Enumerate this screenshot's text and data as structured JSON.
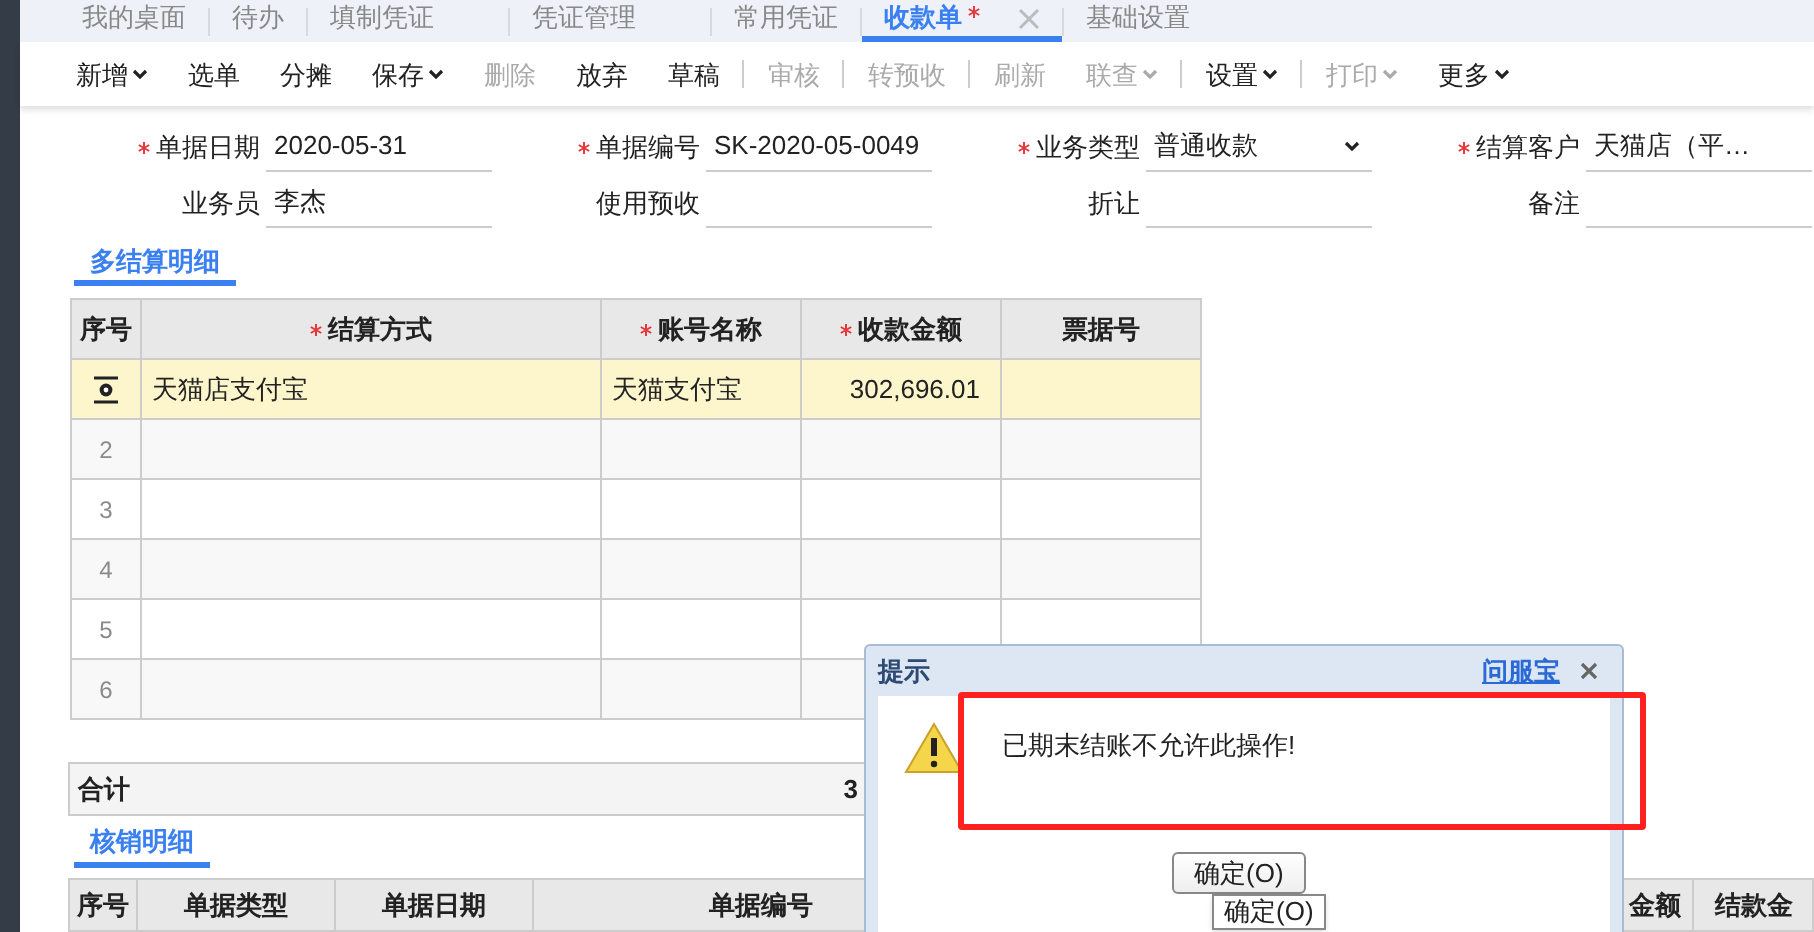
{
  "nav_tabs": [
    {
      "label": "我的桌面",
      "selected": false
    },
    {
      "label": "待办",
      "selected": false
    },
    {
      "label": "填制凭证",
      "selected": false
    },
    {
      "label": "凭证管理",
      "selected": false
    },
    {
      "label": "常用凭证",
      "selected": false
    },
    {
      "label": "收款单",
      "selected": true,
      "modified": true,
      "closable": true
    },
    {
      "label": "基础设置",
      "selected": false
    }
  ],
  "toolbar": [
    {
      "label": "新增",
      "disabled": false,
      "dropdown": true
    },
    {
      "label": "选单",
      "disabled": false
    },
    {
      "label": "分摊",
      "disabled": false
    },
    {
      "label": "保存",
      "disabled": false,
      "dropdown": true
    },
    {
      "label": "删除",
      "disabled": true
    },
    {
      "label": "放弃",
      "disabled": false
    },
    {
      "label": "草稿",
      "disabled": false
    },
    {
      "label": "审核",
      "disabled": true,
      "separator_before": true
    },
    {
      "label": "转预收",
      "disabled": true,
      "separator_before": true
    },
    {
      "label": "刷新",
      "disabled": true,
      "separator_before": true
    },
    {
      "label": "联查",
      "disabled": true,
      "dropdown": true
    },
    {
      "label": "设置",
      "disabled": false,
      "dropdown": true,
      "separator_before": true
    },
    {
      "label": "打印",
      "disabled": true,
      "dropdown": true,
      "separator_before": true
    },
    {
      "label": "更多",
      "disabled": false,
      "dropdown": true
    }
  ],
  "form_rows": [
    [
      {
        "label": "单据日期",
        "required": true,
        "value": "2020-05-31"
      },
      {
        "label": "单据编号",
        "required": true,
        "value": "SK-2020-05-0049"
      },
      {
        "label": "业务类型",
        "required": true,
        "value": "普通收款",
        "kind": "select"
      },
      {
        "label": "结算客户",
        "required": true,
        "value": "天猫店（平…"
      }
    ],
    [
      {
        "label": "业务员",
        "required": false,
        "value": "李杰"
      },
      {
        "label": "使用预收",
        "required": false
      },
      {
        "label": "折让",
        "required": false
      },
      {
        "label": "备注",
        "required": false
      }
    ]
  ],
  "settlement": {
    "title": "多结算明细",
    "columns": [
      {
        "label": "序号",
        "required": false
      },
      {
        "label": "结算方式",
        "required": true
      },
      {
        "label": "账号名称",
        "required": true
      },
      {
        "label": "收款金额",
        "required": true
      },
      {
        "label": "票据号",
        "required": false
      }
    ],
    "rows": [
      {
        "selected": true,
        "cells": [
          "",
          "天猫店支付宝",
          "天猫支付宝",
          "302,696.01"
        ]
      },
      {
        "selected": false,
        "cells": [
          "2"
        ]
      },
      {
        "selected": false,
        "cells": [
          "3"
        ]
      },
      {
        "selected": false,
        "cells": [
          "4"
        ]
      },
      {
        "selected": false,
        "cells": [
          "5"
        ]
      },
      {
        "selected": false,
        "cells": [
          "6"
        ]
      }
    ]
  },
  "total": {
    "label": "合计",
    "value": "3"
  },
  "writeoff": {
    "title": "核销明细",
    "columns": [
      "序号",
      "单据类型",
      "单据日期",
      "单据编号"
    ],
    "columns_right": [
      "金额",
      "结款金"
    ]
  },
  "dialog": {
    "title": "提示",
    "link": "问服宝",
    "message": "已期末结账不允许此操作!",
    "button": "确定(O)",
    "tooltip": "确定(O)"
  }
}
